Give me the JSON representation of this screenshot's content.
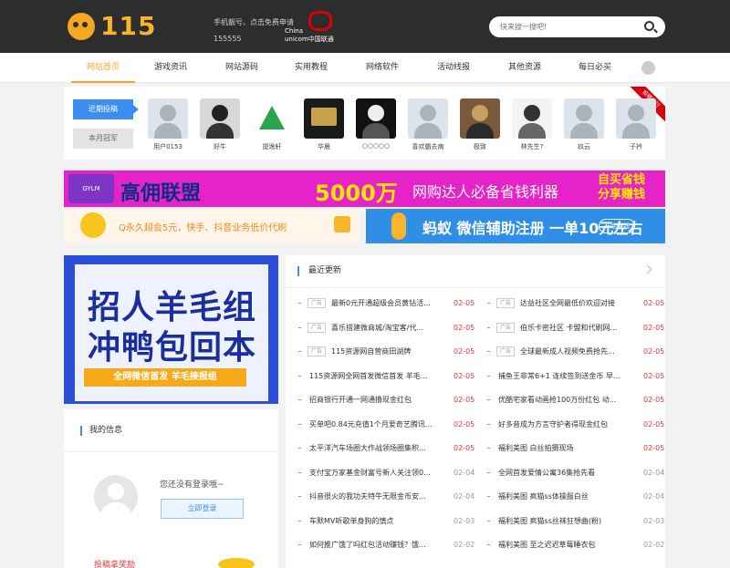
{
  "header": {
    "logo_text": "115",
    "promo_line1": "手机靓号、点击免费申请",
    "promo_line2": "155555",
    "carrier_text1": "China",
    "carrier_text2": "unicom中国联通",
    "search_placeholder": "快来搜一搜吧!"
  },
  "nav": {
    "items": [
      {
        "label": "网站首页",
        "active": true
      },
      {
        "label": "游戏资讯"
      },
      {
        "label": "网站源码"
      },
      {
        "label": "实用教程"
      },
      {
        "label": "网络软件"
      },
      {
        "label": "活动线报"
      },
      {
        "label": "其他资源"
      },
      {
        "label": "每日必买"
      }
    ]
  },
  "contributors": {
    "tab_recent": "近期投稿",
    "tab_month": "本月冠军",
    "ribbon": "投稿排行",
    "users": [
      {
        "name": "用户0153"
      },
      {
        "name": "好牛"
      },
      {
        "name": "提逸轩"
      },
      {
        "name": "华晨"
      },
      {
        "name": "○○○○○"
      },
      {
        "name": "喜欢霸去病"
      },
      {
        "name": "极致"
      },
      {
        "name": "林先生?"
      },
      {
        "name": "玖云"
      },
      {
        "name": "子衿"
      }
    ]
  },
  "banners": {
    "b1_box": "GYLM",
    "b1_title": "高佣联盟",
    "b1_amount": "5000万",
    "b1_slogan": "网购达人必备省钱利器",
    "b1_side1": "自买省钱",
    "b1_side2": "分享赚钱",
    "b2_text": "Q永久超会5元，快手、抖音业务低价代刷",
    "b3_text": "蚂蚁 微信辅助注册 一单10元左右",
    "b3_btn": "开始赚钱"
  },
  "poster": {
    "line1": "招人羊毛组",
    "line2": "冲鸭包回本",
    "bar": "全网微信首发 羊毛接报组"
  },
  "my_info": {
    "title": "我的信息",
    "not_logged": "您还没有登录哦~",
    "login_button": "立即登录",
    "reward": "投稿拿奖励"
  },
  "news": {
    "title": "最近更新",
    "ad_tag": "广告",
    "left": [
      {
        "ad": true,
        "text": "最新0元开通超级会员黄钻活...",
        "date": "02-05"
      },
      {
        "ad": true,
        "text": "喜乐搭建微商城/淘宝客/代...",
        "date": "02-05"
      },
      {
        "ad": true,
        "text": "115资源网自营商田湖牌",
        "date": "02-05"
      },
      {
        "ad": false,
        "text": "115资源网全网首发微信首发 羊毛...",
        "date": "02-05"
      },
      {
        "ad": false,
        "text": "招商银行开通一网通撸现金红包",
        "date": "02-05"
      },
      {
        "ad": false,
        "text": "买单吧0.84元充值1个月爱奇艺腾讯...",
        "date": "02-05"
      },
      {
        "ad": false,
        "text": "太平洋汽车场圈大作战领场圈集积...",
        "date": "02-05"
      },
      {
        "ad": false,
        "text": "支付宝万家基金财富号新人关注领0...",
        "date": "02-04"
      },
      {
        "ad": false,
        "text": "抖音很火的我功夫特牛无限金币安...",
        "date": "02-04"
      },
      {
        "ad": false,
        "text": "车默MV听歌单身狗的慎点",
        "date": "02-03"
      },
      {
        "ad": false,
        "text": "如何推广饿了吗红包活动赚钱？饿...",
        "date": "02-02"
      }
    ],
    "right": [
      {
        "ad": true,
        "text": "达益社区全网最低价欢迎对接",
        "date": "02-05"
      },
      {
        "ad": true,
        "text": "伯乐卡密社区 卡盟和代刷网...",
        "date": "02-05"
      },
      {
        "ad": true,
        "text": "全球最新成人视频免费抢先...",
        "date": "02-05"
      },
      {
        "ad": false,
        "text": "捕鱼王非常6+1 连续签到送金币 早...",
        "date": "02-05"
      },
      {
        "ad": false,
        "text": "优酷宅家看动画抢100万份红包 动...",
        "date": "02-05"
      },
      {
        "ad": false,
        "text": "好多音成为方言守护者得现金红包",
        "date": "02-05"
      },
      {
        "ad": false,
        "text": "福利美图 白丝拍摄现场",
        "date": "02-05"
      },
      {
        "ad": false,
        "text": "全网首发爱情公寓36集抢先看",
        "date": "02-04"
      },
      {
        "ad": false,
        "text": "福利美图 疯猫ss体操服白丝",
        "date": "02-04"
      },
      {
        "ad": false,
        "text": "福利美图 疯猫ss丝袜狂想曲(粉)",
        "date": "02-03"
      },
      {
        "ad": false,
        "text": "福利美图 至之迟迟草莓睡衣包",
        "date": "02-02"
      }
    ]
  },
  "colors": {
    "accent": "#f5a623",
    "primary_blue": "#3c8ef3",
    "header_bg": "#2d2d2d",
    "date_red": "#e5343a"
  }
}
